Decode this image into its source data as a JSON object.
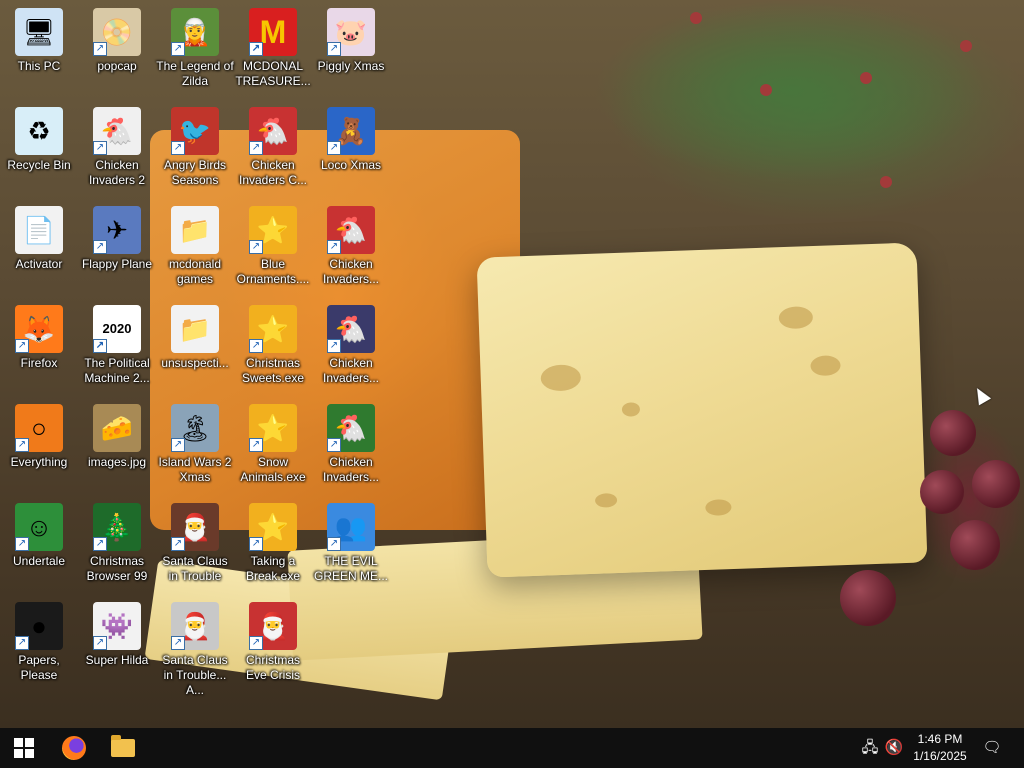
{
  "desktop": {
    "icons": [
      {
        "label": "This PC",
        "glyph": "🖥",
        "bg": "#cfe3f5",
        "shortcut": false
      },
      {
        "label": "popcap",
        "glyph": "📀",
        "bg": "#d9c9a6",
        "shortcut": true
      },
      {
        "label": "The Legend of Zilda",
        "glyph": "🧝",
        "bg": "#5b8f3a",
        "shortcut": true
      },
      {
        "label": "MCDONAL TREASURE...",
        "glyph": "M",
        "bg": "#d91f1f",
        "shortcut": true
      },
      {
        "label": "Piggly Xmas",
        "glyph": "🐷",
        "bg": "#e9d8e8",
        "shortcut": true
      },
      {
        "label": "Recycle Bin",
        "glyph": "♻",
        "bg": "#d8eef8",
        "shortcut": false
      },
      {
        "label": "Chicken Invaders 2",
        "glyph": "🐔",
        "bg": "#f0f0f0",
        "shortcut": true
      },
      {
        "label": "Angry Birds Seasons",
        "glyph": "🐦",
        "bg": "#c0352b",
        "shortcut": true
      },
      {
        "label": "Chicken Invaders C...",
        "glyph": "🐔",
        "bg": "#c83232",
        "shortcut": true
      },
      {
        "label": "Loco Xmas",
        "glyph": "🧸",
        "bg": "#2a66c8",
        "shortcut": true
      },
      {
        "label": "Activator",
        "glyph": "📄",
        "bg": "#f2f2f2",
        "shortcut": false
      },
      {
        "label": "Flappy Plane",
        "glyph": "✈",
        "bg": "#5a7abf",
        "shortcut": true
      },
      {
        "label": "mcdonald games",
        "glyph": "📁",
        "bg": "#f2f2f2",
        "shortcut": false
      },
      {
        "label": "Blue Ornaments....",
        "glyph": "⭐",
        "bg": "#f2b01e",
        "shortcut": true
      },
      {
        "label": "Chicken Invaders...",
        "glyph": "🐔",
        "bg": "#c83232",
        "shortcut": true
      },
      {
        "label": "Firefox",
        "glyph": "🦊",
        "bg": "#ff7a1a",
        "shortcut": true
      },
      {
        "label": "The Political Machine 2...",
        "glyph": "2020",
        "bg": "#ffffff",
        "shortcut": true
      },
      {
        "label": "unsuspecti...",
        "glyph": "📁",
        "bg": "#f2f2f2",
        "shortcut": false
      },
      {
        "label": "Christmas Sweets.exe",
        "glyph": "⭐",
        "bg": "#f2b01e",
        "shortcut": true
      },
      {
        "label": "Chicken Invaders...",
        "glyph": "🐔",
        "bg": "#3a3a6a",
        "shortcut": true
      },
      {
        "label": "Everything",
        "glyph": "○",
        "bg": "#f07a1a",
        "shortcut": true
      },
      {
        "label": "images.jpg",
        "glyph": "🧀",
        "bg": "#a88a55",
        "shortcut": false
      },
      {
        "label": "Island Wars 2 Xmas",
        "glyph": "🏝",
        "bg": "#8aa3b8",
        "shortcut": true
      },
      {
        "label": "Snow Animals.exe",
        "glyph": "⭐",
        "bg": "#f2b01e",
        "shortcut": true
      },
      {
        "label": "Chicken Invaders...",
        "glyph": "🐔",
        "bg": "#2f7a2f",
        "shortcut": true
      },
      {
        "label": "Undertale",
        "glyph": "☺",
        "bg": "#2d8f3a",
        "shortcut": true
      },
      {
        "label": "Christmas Browser 99",
        "glyph": "🎄",
        "bg": "#1e6b2a",
        "shortcut": true
      },
      {
        "label": "Santa Claus in Trouble",
        "glyph": "🎅",
        "bg": "#6a3a2a",
        "shortcut": true
      },
      {
        "label": "Taking a Break.exe",
        "glyph": "⭐",
        "bg": "#f2b01e",
        "shortcut": true
      },
      {
        "label": "THE EVIL GREEN ME...",
        "glyph": "👥",
        "bg": "#3a8ae0",
        "shortcut": true
      },
      {
        "label": "Papers, Please",
        "glyph": "●",
        "bg": "#1a1a1a",
        "shortcut": true
      },
      {
        "label": "Super Hilda",
        "glyph": "👾",
        "bg": "#f2f2f2",
        "shortcut": true
      },
      {
        "label": "Santa Claus in Trouble... A...",
        "glyph": "🎅",
        "bg": "#c8c8c8",
        "shortcut": true
      },
      {
        "label": "Christmas Eve Crisis",
        "glyph": "🎅",
        "bg": "#c83232",
        "shortcut": true
      }
    ]
  },
  "taskbar": {
    "start_icon": "windows-logo-icon",
    "pinned": [
      {
        "name": "firefox-taskbar-icon"
      },
      {
        "name": "file-explorer-taskbar-icon"
      }
    ],
    "tray": {
      "network_glyph": "🖧",
      "volume_glyph": "🔇",
      "notification_glyph": "🗨"
    },
    "clock": {
      "time": "1:46 PM",
      "date": "1/16/2025"
    }
  }
}
